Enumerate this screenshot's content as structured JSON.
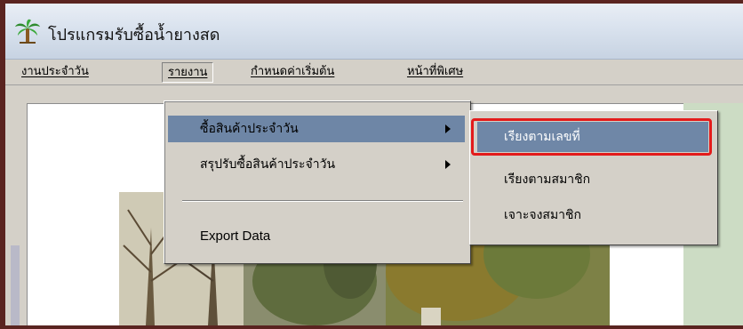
{
  "window": {
    "title": "โปรแกรมรับซื้อน้ำยางสด",
    "icon": "palm-tree-icon"
  },
  "menubar": {
    "items": [
      {
        "label": "งานประจำวัน"
      },
      {
        "label": "รายงาน"
      },
      {
        "label": "กำหนดค่าเริ่มต้น"
      },
      {
        "label": "หน้าที่พิเศษ"
      }
    ]
  },
  "dropdown": {
    "items": [
      {
        "label": "ซื้อสินค้าประจำวัน",
        "has_submenu": true,
        "selected": true
      },
      {
        "label": "สรุปรับซื้อสินค้าประจำวัน",
        "has_submenu": true
      },
      {
        "label": "Export Data"
      }
    ]
  },
  "submenu": {
    "items": [
      {
        "label": "เรียงตามเลขที่",
        "selected": true
      },
      {
        "label": "เรียงตามสมาชิก"
      },
      {
        "label": "เจาะจงสมาชิก"
      }
    ]
  },
  "colors": {
    "highlight": "#6f87a7",
    "callout_border": "#e31b1b",
    "menu_bg": "#d4d0c8"
  }
}
